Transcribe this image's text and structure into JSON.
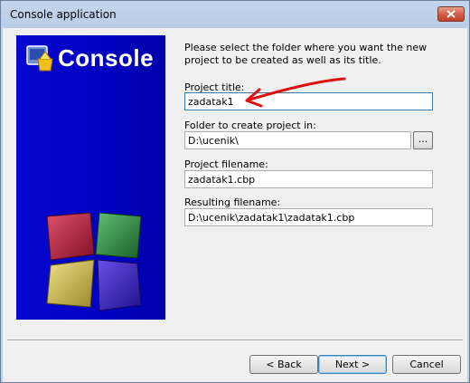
{
  "window": {
    "title": "Console application"
  },
  "banner": {
    "title": "Console",
    "colors": {
      "background": "#0000c0",
      "cube_red": "#b0203c",
      "cube_green": "#2e8a3e",
      "cube_yellow": "#c8b84a",
      "cube_purple": "#3a22b8"
    }
  },
  "page": {
    "intro": "Please select the folder where you want the new project to be created as well as its title.",
    "project_title_label": "Project title:",
    "project_title_value": "zadatak1",
    "folder_label": "Folder to create project in:",
    "folder_value": "D:\\ucenik\\",
    "browse_label": "...",
    "filename_label": "Project filename:",
    "filename_value": "zadatak1.cbp",
    "resulting_label": "Resulting filename:",
    "resulting_value": "D:\\ucenik\\zadatak1\\zadatak1.cbp"
  },
  "buttons": {
    "back": "< Back",
    "next": "Next >",
    "cancel": "Cancel"
  },
  "annotation": {
    "arrow_color": "#e01010"
  }
}
